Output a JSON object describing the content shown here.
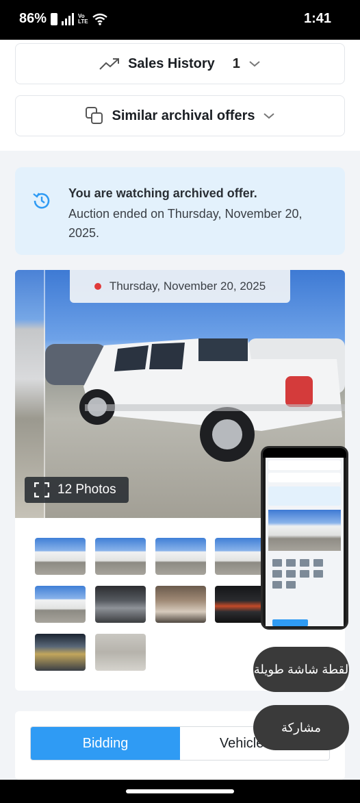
{
  "status_bar": {
    "battery": "86%",
    "network": "Vo LTE",
    "time": "1:41"
  },
  "accordions": {
    "sales_history": {
      "label": "Sales History",
      "count": "1",
      "icon": "trend-up-icon"
    },
    "similar_offers": {
      "label": "Similar archival offers",
      "icon": "copy-icon"
    }
  },
  "notice": {
    "title": "You are watching archived offer.",
    "text": "Auction ended on Thursday, November 20, 2025.",
    "icon": "history-icon"
  },
  "gallery": {
    "date": "Thursday, November 20, 2025",
    "photos_label": "12 Photos",
    "thumbnail_count": 10
  },
  "tabs": {
    "bidding": "Bidding",
    "vehicle_info": "Vehicle info"
  },
  "overlays": {
    "long_screenshot": "لقطة شاشة طويلة",
    "share": "مشاركة"
  },
  "colors": {
    "accent": "#2f9bf4",
    "notice_bg": "#e3f1fc",
    "date_dot": "#e03a3a"
  }
}
